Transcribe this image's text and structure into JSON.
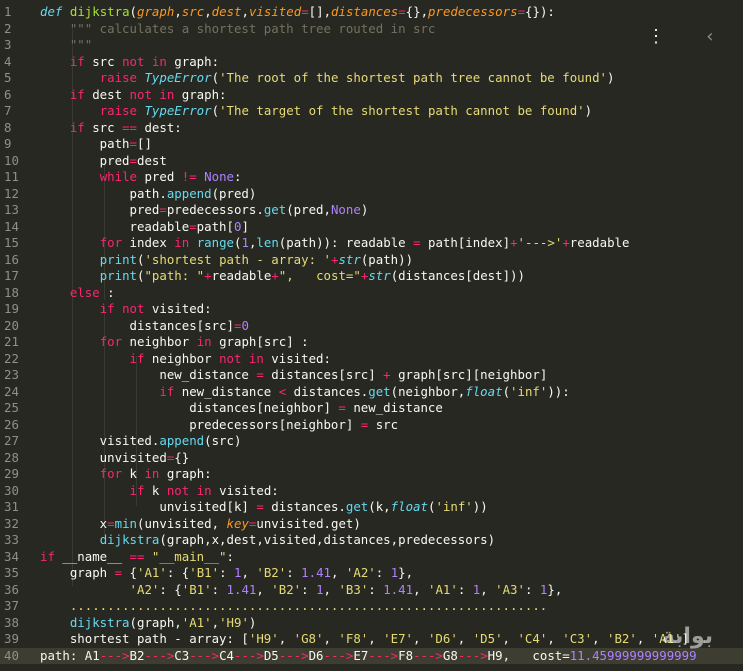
{
  "overlay": {
    "more_icon": "⋮",
    "back_icon": "‹"
  },
  "watermark": "ﺑﻮﺍﺑﺔ",
  "lines": [
    {
      "n": "1",
      "tokens": [
        [
          "def",
          "def"
        ],
        [
          "",
          " "
        ],
        [
          "fn",
          "dijkstra"
        ],
        [
          "",
          "("
        ],
        [
          "param",
          "graph"
        ],
        [
          "",
          ","
        ],
        [
          "param",
          "src"
        ],
        [
          "",
          ","
        ],
        [
          "param",
          "dest"
        ],
        [
          "",
          ","
        ],
        [
          "param",
          "visited"
        ],
        [
          "kw",
          "="
        ],
        [
          "",
          "[],"
        ],
        [
          "param",
          "distances"
        ],
        [
          "kw",
          "="
        ],
        [
          "",
          "{},"
        ],
        [
          "param",
          "predecessors"
        ],
        [
          "kw",
          "="
        ],
        [
          "",
          "{}):"
        ]
      ]
    },
    {
      "n": "2",
      "tokens": [
        [
          "cmt",
          "    \"\"\" calculates a shortest path tree routed in src"
        ]
      ]
    },
    {
      "n": "3",
      "tokens": [
        [
          "cmt",
          "    \"\"\""
        ]
      ]
    },
    {
      "n": "4",
      "tokens": [
        [
          "",
          "    "
        ],
        [
          "kw",
          "if"
        ],
        [
          "",
          " src "
        ],
        [
          "kw",
          "not in"
        ],
        [
          "",
          " graph:"
        ]
      ]
    },
    {
      "n": "5",
      "tokens": [
        [
          "",
          "        "
        ],
        [
          "kw",
          "raise"
        ],
        [
          "",
          " "
        ],
        [
          "cls",
          "TypeError"
        ],
        [
          "",
          "("
        ],
        [
          "str",
          "'The root of the shortest path tree cannot be found'"
        ],
        [
          "",
          ")"
        ]
      ]
    },
    {
      "n": "6",
      "tokens": [
        [
          "",
          "    "
        ],
        [
          "kw",
          "if"
        ],
        [
          "",
          " dest "
        ],
        [
          "kw",
          "not in"
        ],
        [
          "",
          " graph:"
        ]
      ]
    },
    {
      "n": "7",
      "tokens": [
        [
          "",
          "        "
        ],
        [
          "kw",
          "raise"
        ],
        [
          "",
          " "
        ],
        [
          "cls",
          "TypeError"
        ],
        [
          "",
          "("
        ],
        [
          "str",
          "'The target of the shortest path cannot be found'"
        ],
        [
          "",
          ")"
        ]
      ]
    },
    {
      "n": "8",
      "tokens": [
        [
          "",
          "    "
        ],
        [
          "kw",
          "if"
        ],
        [
          "",
          " src "
        ],
        [
          "kw",
          "=="
        ],
        [
          "",
          " dest:"
        ]
      ]
    },
    {
      "n": "9",
      "tokens": [
        [
          "",
          "        path"
        ],
        [
          "kw",
          "="
        ],
        [
          "",
          "[]"
        ]
      ]
    },
    {
      "n": "10",
      "tokens": [
        [
          "",
          "        pred"
        ],
        [
          "kw",
          "="
        ],
        [
          "",
          "dest"
        ]
      ]
    },
    {
      "n": "11",
      "tokens": [
        [
          "",
          "        "
        ],
        [
          "kw",
          "while"
        ],
        [
          "",
          " pred "
        ],
        [
          "kw",
          "!="
        ],
        [
          "",
          " "
        ],
        [
          "num",
          "None"
        ],
        [
          "",
          ":"
        ]
      ]
    },
    {
      "n": "12",
      "tokens": [
        [
          "",
          "            path."
        ],
        [
          "builtin",
          "append"
        ],
        [
          "",
          "(pred)"
        ]
      ]
    },
    {
      "n": "13",
      "tokens": [
        [
          "",
          "            pred"
        ],
        [
          "kw",
          "="
        ],
        [
          "",
          "predecessors."
        ],
        [
          "builtin",
          "get"
        ],
        [
          "",
          "(pred,"
        ],
        [
          "num",
          "None"
        ],
        [
          "",
          ")"
        ]
      ]
    },
    {
      "n": "14",
      "tokens": [
        [
          "",
          "            readable"
        ],
        [
          "kw",
          "="
        ],
        [
          "",
          "path["
        ],
        [
          "num",
          "0"
        ],
        [
          "",
          "]"
        ]
      ]
    },
    {
      "n": "15",
      "tokens": [
        [
          "",
          "        "
        ],
        [
          "kw",
          "for"
        ],
        [
          "",
          " index "
        ],
        [
          "kw",
          "in"
        ],
        [
          "",
          " "
        ],
        [
          "builtin",
          "range"
        ],
        [
          "",
          "("
        ],
        [
          "num",
          "1"
        ],
        [
          "",
          ","
        ],
        [
          "builtin",
          "len"
        ],
        [
          "",
          "(path)): readable "
        ],
        [
          "kw",
          "="
        ],
        [
          "",
          " path[index]"
        ],
        [
          "kw",
          "+"
        ],
        [
          "str",
          "'--->'"
        ],
        [
          "kw",
          "+"
        ],
        [
          "",
          "readable"
        ]
      ]
    },
    {
      "n": "16",
      "tokens": [
        [
          "",
          "        "
        ],
        [
          "builtin",
          "print"
        ],
        [
          "",
          "("
        ],
        [
          "str",
          "'shortest path - array: '"
        ],
        [
          "kw",
          "+"
        ],
        [
          "cls",
          "str"
        ],
        [
          "",
          "(path))"
        ]
      ]
    },
    {
      "n": "17",
      "tokens": [
        [
          "",
          "        "
        ],
        [
          "builtin",
          "print"
        ],
        [
          "",
          "("
        ],
        [
          "str",
          "\"path: \""
        ],
        [
          "kw",
          "+"
        ],
        [
          "",
          "readable"
        ],
        [
          "kw",
          "+"
        ],
        [
          "str",
          "\",   cost=\""
        ],
        [
          "kw",
          "+"
        ],
        [
          "cls",
          "str"
        ],
        [
          "",
          "(distances[dest]))"
        ]
      ]
    },
    {
      "n": "18",
      "tokens": [
        [
          "",
          "    "
        ],
        [
          "kw",
          "else"
        ],
        [
          "",
          " :"
        ]
      ]
    },
    {
      "n": "19",
      "tokens": [
        [
          "",
          "        "
        ],
        [
          "kw",
          "if"
        ],
        [
          "",
          " "
        ],
        [
          "kw",
          "not"
        ],
        [
          "",
          " visited:"
        ]
      ]
    },
    {
      "n": "20",
      "tokens": [
        [
          "",
          "            distances[src]"
        ],
        [
          "kw",
          "="
        ],
        [
          "num",
          "0"
        ]
      ]
    },
    {
      "n": "21",
      "tokens": [
        [
          "",
          "        "
        ],
        [
          "kw",
          "for"
        ],
        [
          "",
          " neighbor "
        ],
        [
          "kw",
          "in"
        ],
        [
          "",
          " graph[src] :"
        ]
      ]
    },
    {
      "n": "22",
      "tokens": [
        [
          "",
          "            "
        ],
        [
          "kw",
          "if"
        ],
        [
          "",
          " neighbor "
        ],
        [
          "kw",
          "not in"
        ],
        [
          "",
          " visited:"
        ]
      ]
    },
    {
      "n": "23",
      "tokens": [
        [
          "",
          "                new_distance "
        ],
        [
          "kw",
          "="
        ],
        [
          "",
          " distances[src] "
        ],
        [
          "kw",
          "+"
        ],
        [
          "",
          " graph[src][neighbor]"
        ]
      ]
    },
    {
      "n": "24",
      "tokens": [
        [
          "",
          "                "
        ],
        [
          "kw",
          "if"
        ],
        [
          "",
          " new_distance "
        ],
        [
          "kw",
          "<"
        ],
        [
          "",
          " distances."
        ],
        [
          "builtin",
          "get"
        ],
        [
          "",
          "(neighbor,"
        ],
        [
          "cls",
          "float"
        ],
        [
          "",
          "("
        ],
        [
          "str",
          "'inf'"
        ],
        [
          "",
          "))"
        ],
        [
          "",
          ":"
        ]
      ]
    },
    {
      "n": "25",
      "tokens": [
        [
          "",
          "                    distances[neighbor] "
        ],
        [
          "kw",
          "="
        ],
        [
          "",
          " new_distance"
        ]
      ]
    },
    {
      "n": "26",
      "tokens": [
        [
          "",
          "                    predecessors[neighbor] "
        ],
        [
          "kw",
          "="
        ],
        [
          "",
          " src"
        ]
      ]
    },
    {
      "n": "27",
      "tokens": [
        [
          "",
          "        visited."
        ],
        [
          "builtin",
          "append"
        ],
        [
          "",
          "(src)"
        ]
      ]
    },
    {
      "n": "28",
      "tokens": [
        [
          "",
          "        unvisited"
        ],
        [
          "kw",
          "="
        ],
        [
          "",
          "{}"
        ]
      ]
    },
    {
      "n": "29",
      "tokens": [
        [
          "",
          "        "
        ],
        [
          "kw",
          "for"
        ],
        [
          "",
          " k "
        ],
        [
          "kw",
          "in"
        ],
        [
          "",
          " graph:"
        ]
      ]
    },
    {
      "n": "30",
      "tokens": [
        [
          "",
          "            "
        ],
        [
          "kw",
          "if"
        ],
        [
          "",
          " k "
        ],
        [
          "kw",
          "not in"
        ],
        [
          "",
          " visited:"
        ]
      ]
    },
    {
      "n": "31",
      "tokens": [
        [
          "",
          "                unvisited[k] "
        ],
        [
          "kw",
          "="
        ],
        [
          "",
          " distances."
        ],
        [
          "builtin",
          "get"
        ],
        [
          "",
          "(k,"
        ],
        [
          "cls",
          "float"
        ],
        [
          "",
          "("
        ],
        [
          "str",
          "'inf'"
        ],
        [
          "",
          "))"
        ]
      ]
    },
    {
      "n": "32",
      "tokens": [
        [
          "",
          "        x"
        ],
        [
          "kw",
          "="
        ],
        [
          "builtin",
          "min"
        ],
        [
          "",
          "(unvisited, "
        ],
        [
          "param",
          "key"
        ],
        [
          "kw",
          "="
        ],
        [
          "",
          "unvisited.get)"
        ]
      ]
    },
    {
      "n": "33",
      "tokens": [
        [
          "",
          "        "
        ],
        [
          "builtin",
          "dijkstra"
        ],
        [
          "",
          "(graph,x,dest,visited,distances,predecessors)"
        ]
      ]
    },
    {
      "n": "34",
      "tokens": [
        [
          "kw",
          "if"
        ],
        [
          "",
          " __name__ "
        ],
        [
          "kw",
          "=="
        ],
        [
          "",
          " "
        ],
        [
          "str",
          "\"__main__\""
        ],
        [
          "",
          ":"
        ]
      ]
    },
    {
      "n": "35",
      "tokens": [
        [
          "",
          "    graph "
        ],
        [
          "kw",
          "="
        ],
        [
          "",
          " {"
        ],
        [
          "str",
          "'A1'"
        ],
        [
          "",
          ": {"
        ],
        [
          "str",
          "'B1'"
        ],
        [
          "",
          ": "
        ],
        [
          "num",
          "1"
        ],
        [
          "",
          ", "
        ],
        [
          "str",
          "'B2'"
        ],
        [
          "",
          ": "
        ],
        [
          "num",
          "1.41"
        ],
        [
          "",
          ", "
        ],
        [
          "str",
          "'A2'"
        ],
        [
          "",
          ": "
        ],
        [
          "num",
          "1"
        ],
        [
          "",
          "},"
        ]
      ]
    },
    {
      "n": "36",
      "tokens": [
        [
          "",
          "            "
        ],
        [
          "str",
          "'A2'"
        ],
        [
          "",
          ": {"
        ],
        [
          "str",
          "'B1'"
        ],
        [
          "",
          ": "
        ],
        [
          "num",
          "1.41"
        ],
        [
          "",
          ", "
        ],
        [
          "str",
          "'B2'"
        ],
        [
          "",
          ": "
        ],
        [
          "num",
          "1"
        ],
        [
          "",
          ", "
        ],
        [
          "str",
          "'B3'"
        ],
        [
          "",
          ": "
        ],
        [
          "num",
          "1.41"
        ],
        [
          "",
          ", "
        ],
        [
          "str",
          "'A1'"
        ],
        [
          "",
          ": "
        ],
        [
          "num",
          "1"
        ],
        [
          "",
          ", "
        ],
        [
          "str",
          "'A3'"
        ],
        [
          "",
          ": "
        ],
        [
          "num",
          "1"
        ],
        [
          "",
          "},"
        ]
      ]
    },
    {
      "n": "37",
      "tokens": [
        [
          "str",
          "    ................................................................"
        ]
      ]
    },
    {
      "n": "38",
      "tokens": [
        [
          "",
          "    "
        ],
        [
          "builtin",
          "dijkstra"
        ],
        [
          "",
          "(graph,"
        ],
        [
          "str",
          "'A1'"
        ],
        [
          "",
          ","
        ],
        [
          "str",
          "'H9'"
        ],
        [
          "",
          ")"
        ]
      ]
    },
    {
      "n": "39",
      "tokens": [
        [
          "",
          "    shortest path - array: ["
        ],
        [
          "str",
          "'H9'"
        ],
        [
          "",
          ", "
        ],
        [
          "str",
          "'G8'"
        ],
        [
          "",
          ", "
        ],
        [
          "str",
          "'F8'"
        ],
        [
          "",
          ", "
        ],
        [
          "str",
          "'E7'"
        ],
        [
          "",
          ", "
        ],
        [
          "str",
          "'D6'"
        ],
        [
          "",
          ", "
        ],
        [
          "str",
          "'D5'"
        ],
        [
          "",
          ", "
        ],
        [
          "str",
          "'C4'"
        ],
        [
          "",
          ", "
        ],
        [
          "str",
          "'C3'"
        ],
        [
          "",
          ", "
        ],
        [
          "str",
          "'B2'"
        ],
        [
          "",
          ", "
        ],
        [
          "str",
          "'A1'"
        ],
        [
          "",
          "]"
        ]
      ]
    },
    {
      "n": "40",
      "current": true,
      "tokens": [
        [
          "",
          "path: A1"
        ],
        [
          "kw",
          "--->"
        ],
        [
          "",
          "B2"
        ],
        [
          "kw",
          "--->"
        ],
        [
          "",
          "C3"
        ],
        [
          "kw",
          "--->"
        ],
        [
          "",
          "C4"
        ],
        [
          "kw",
          "--->"
        ],
        [
          "",
          "D5"
        ],
        [
          "kw",
          "--->"
        ],
        [
          "",
          "D6"
        ],
        [
          "kw",
          "--->"
        ],
        [
          "",
          "E7"
        ],
        [
          "kw",
          "--->"
        ],
        [
          "",
          "F8"
        ],
        [
          "kw",
          "--->"
        ],
        [
          "",
          "G8"
        ],
        [
          "kw",
          "--->"
        ],
        [
          "",
          "H9,   cost="
        ],
        [
          "num",
          "11.45999999999999"
        ]
      ]
    }
  ]
}
